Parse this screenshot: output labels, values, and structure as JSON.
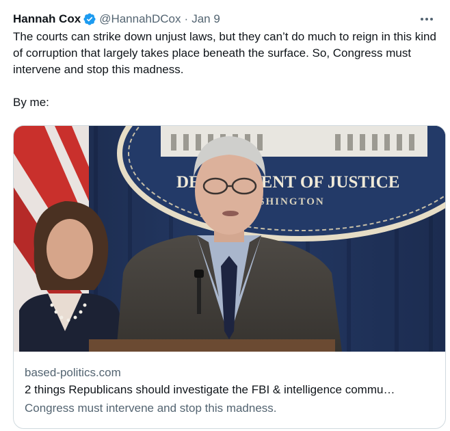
{
  "tweet": {
    "author": {
      "display_name": "Hannah Cox",
      "handle": "@HannahDCox",
      "verified_icon": "verified-badge-icon",
      "verified_color": "#1d9bf0"
    },
    "separator": "·",
    "timestamp": "Jan 9",
    "more_icon": "more-options-icon",
    "text": {
      "paragraph_1": "The courts can strike down unjust laws, but they can’t do much to reign in this kind of corruption that largely takes place beneath the surface. So, Congress must intervene and stop this madness.",
      "paragraph_2": "By me:"
    },
    "card": {
      "image_seal_text_1": "DEPARTMENT OF JUSTICE",
      "image_seal_text_2": "WASHINGTON",
      "domain": "based-politics.com",
      "title": "2 things Republicans should investigate the FBI & intelligence commu…",
      "description": "Congress must intervene and stop this madness."
    }
  },
  "colors": {
    "text_primary": "#0f1419",
    "text_secondary": "#536471",
    "card_border": "#cfd9de"
  }
}
